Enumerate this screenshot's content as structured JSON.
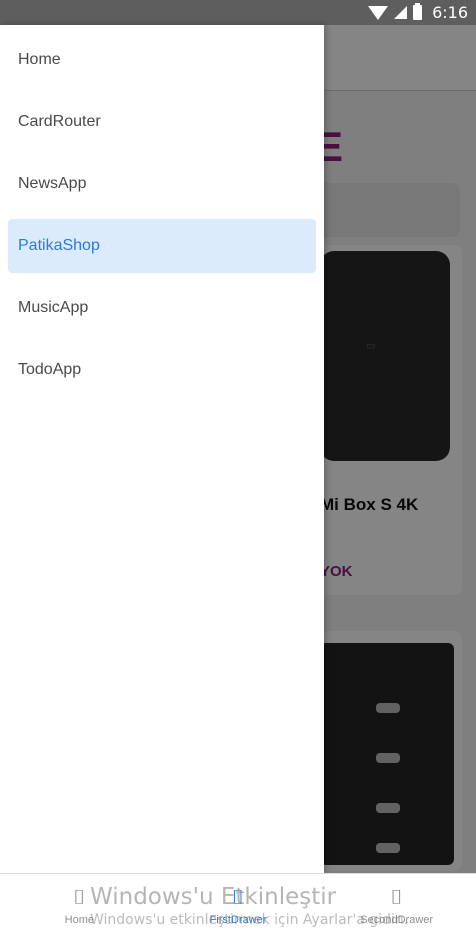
{
  "status_bar": {
    "time": "6:16",
    "icons": [
      "wifi-icon",
      "cell-signal-icon",
      "battery-icon"
    ]
  },
  "background_app": {
    "store_title": "ORE",
    "products": [
      {
        "name": "Mi Box S 4K",
        "stock_label": "YOK"
      },
      {
        "name": "",
        "stock_label": ""
      }
    ],
    "accent_color": "#8e1f7f"
  },
  "drawer": {
    "items": [
      {
        "label": "Home",
        "active": false
      },
      {
        "label": "CardRouter",
        "active": false
      },
      {
        "label": "NewsApp",
        "active": false
      },
      {
        "label": "PatikaShop",
        "active": true
      },
      {
        "label": "MusicApp",
        "active": false
      },
      {
        "label": "TodoApp",
        "active": false
      }
    ],
    "active_color": "#2b7bd6",
    "active_bg": "#dcebfb"
  },
  "tab_bar": {
    "tabs": [
      {
        "label": "Home",
        "icon": "missing-glyph-icon",
        "glyph": "⌷",
        "active": false
      },
      {
        "label": "FirstDrawer",
        "icon": "missing-glyph-icon",
        "glyph": "⌷",
        "active": true
      },
      {
        "label": "SecondDrawer",
        "icon": "missing-glyph-icon",
        "glyph": "⌷",
        "active": false
      }
    ]
  },
  "watermark": {
    "title": "Windows'u Etkinleştir",
    "subtitle": "Windows'u etkinleştirmek için Ayarlar'a gidin."
  }
}
